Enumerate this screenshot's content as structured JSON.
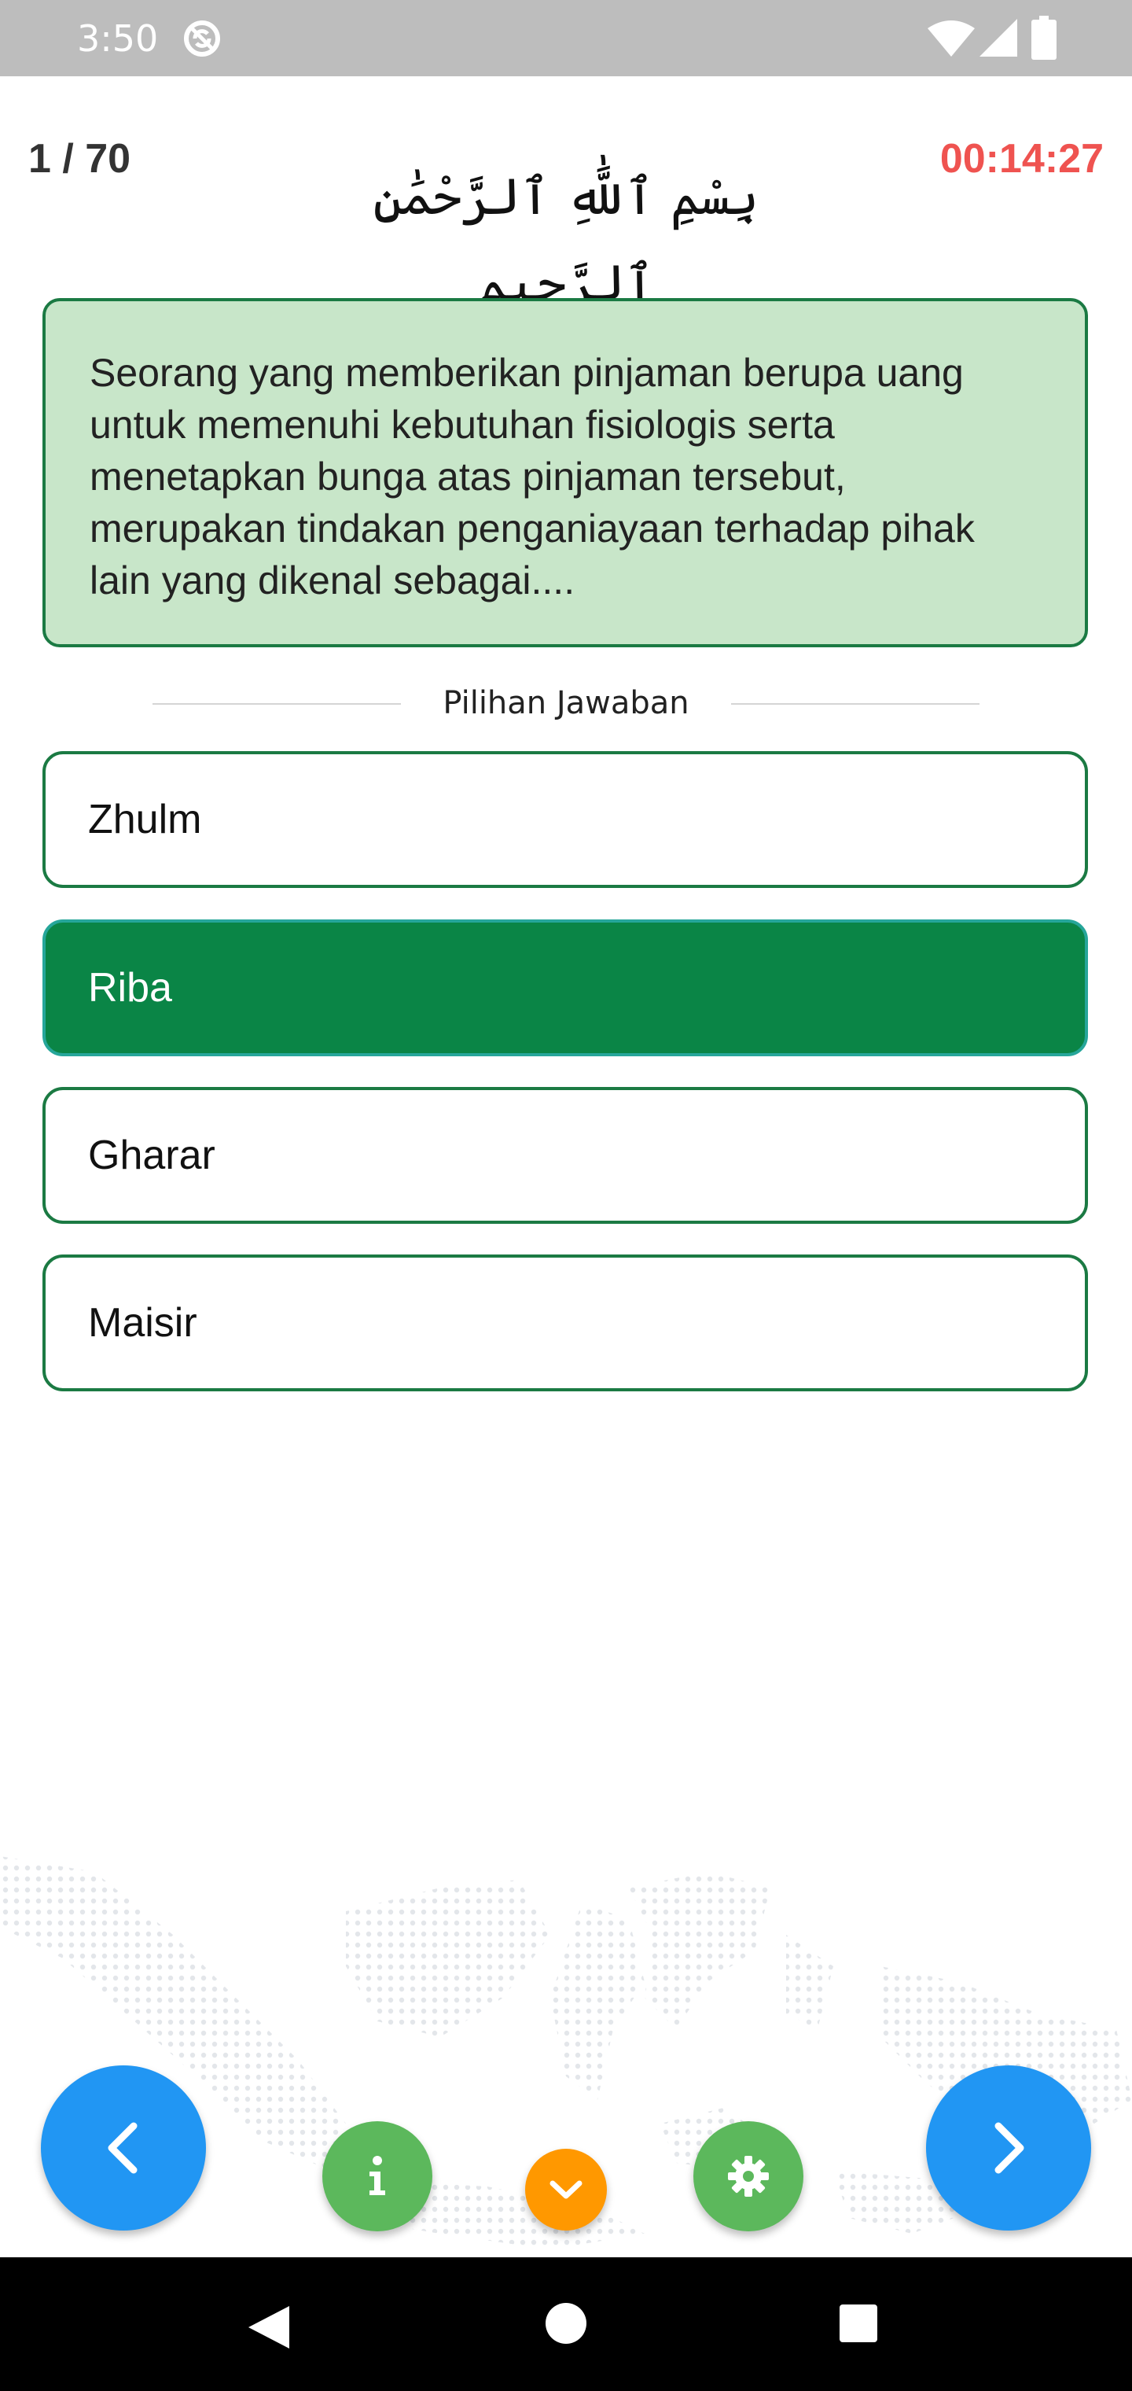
{
  "status_bar": {
    "time": "3:50"
  },
  "header": {
    "counter": "1 / 70",
    "timer": "00:14:27",
    "basmala": "بِسْمِ ٱللَّٰهِ ٱلرَّحْمَٰنِ ٱلرَّحِيمِ"
  },
  "question": {
    "text": "Seorang yang memberikan pinjaman berupa uang untuk memenuhi kebutuhan fisiologis serta menetapkan bunga atas pinjaman tersebut, merupakan tindakan penganiayaan terhadap pihak lain yang dikenal sebagai...."
  },
  "divider_label": "Pilihan Jawaban",
  "options": [
    {
      "label": "Zhulm",
      "selected": false
    },
    {
      "label": "Riba",
      "selected": true
    },
    {
      "label": "Gharar",
      "selected": false
    },
    {
      "label": "Maisir",
      "selected": false
    }
  ],
  "colors": {
    "question_bg": "#c8e6c9",
    "border_green": "#1b7a43",
    "selected_bg": "#0a8546",
    "timer": "#ef5350",
    "nav_blue": "#2196f3",
    "action_green": "#5cb85c",
    "action_orange": "#ff9800"
  },
  "icons": {
    "prev": "chevron-left-icon",
    "next": "chevron-right-icon",
    "info": "info-icon",
    "down": "chevron-down-icon",
    "settings": "gear-icon"
  }
}
